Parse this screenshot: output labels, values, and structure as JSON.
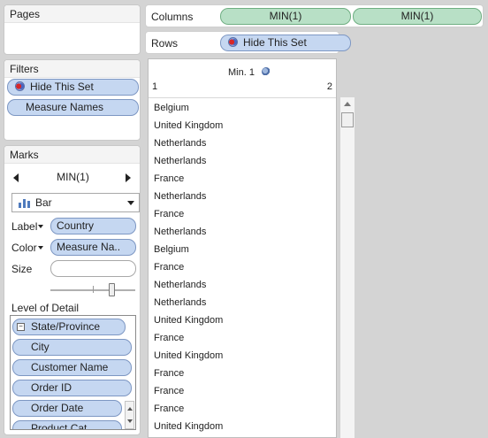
{
  "pages": {
    "title": "Pages"
  },
  "filters": {
    "title": "Filters",
    "items": [
      "Hide This Set",
      "Measure Names"
    ]
  },
  "columns": {
    "label": "Columns",
    "pills": [
      "MIN(1)",
      "MIN(1)"
    ]
  },
  "rows": {
    "label": "Rows",
    "pill": "Hide This Set"
  },
  "marks": {
    "title": "Marks",
    "measure": "MIN(1)",
    "mark_type": "Bar",
    "label_text": "Label",
    "label_pill": "Country",
    "color_text": "Color",
    "color_pill": "Measure Na..",
    "size_text": "Size",
    "size_slider_value": 0.5
  },
  "lod": {
    "title": "Level of Detail",
    "items": [
      "State/Province",
      "City",
      "Customer Name",
      "Order ID",
      "Order Date",
      "Product Cat..."
    ]
  },
  "sheet": {
    "header": "Min. 1",
    "axis_min": "1",
    "axis_max": "2",
    "countries": [
      "Belgium",
      "United Kingdom",
      "Netherlands",
      "Netherlands",
      "France",
      "Netherlands",
      "France",
      "Netherlands",
      "Belgium",
      "France",
      "Netherlands",
      "Netherlands",
      "United Kingdom",
      "France",
      "United Kingdom",
      "France",
      "France",
      "France",
      "United Kingdom"
    ]
  },
  "colors": {
    "pill_blue": "#c5d7f1",
    "pill_green": "#b8e0c6",
    "background": "#d4d4d4"
  }
}
